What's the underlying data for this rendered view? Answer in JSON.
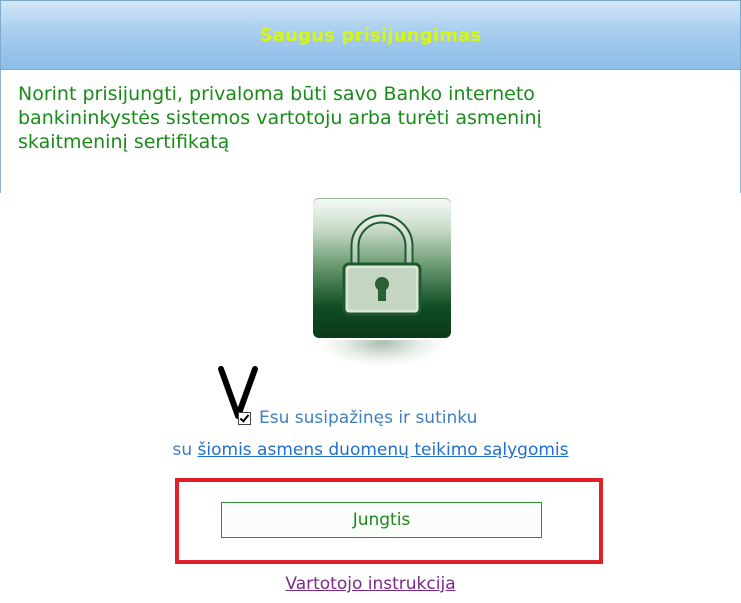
{
  "header": {
    "title": "Saugus prisijungimas"
  },
  "intro": {
    "line1": "Norint prisijungti, privaloma būti savo Banko interneto",
    "line2": "bankininkystės sistemos vartotoju arba turėti asmeninį",
    "line3": "skaitmeninį sertifikatą"
  },
  "agreement": {
    "checked": true,
    "checkbox_label": "Esu susipažinęs ir sutinku",
    "prefix": "su",
    "terms_link": "šiomis asmens duomenų teikimo sąlygomis"
  },
  "login_button": "Jungtis",
  "instructions_link": "Vartotojo instrukcija",
  "colors": {
    "header_text": "#d9f70a",
    "intro_text": "#1a8a1a",
    "link": "#1f6fcf",
    "visited_link": "#7b2a8a",
    "highlight": "#e2202a"
  },
  "icons": {
    "lock": "padlock-icon",
    "annotation": "hand-drawn-v-mark"
  }
}
